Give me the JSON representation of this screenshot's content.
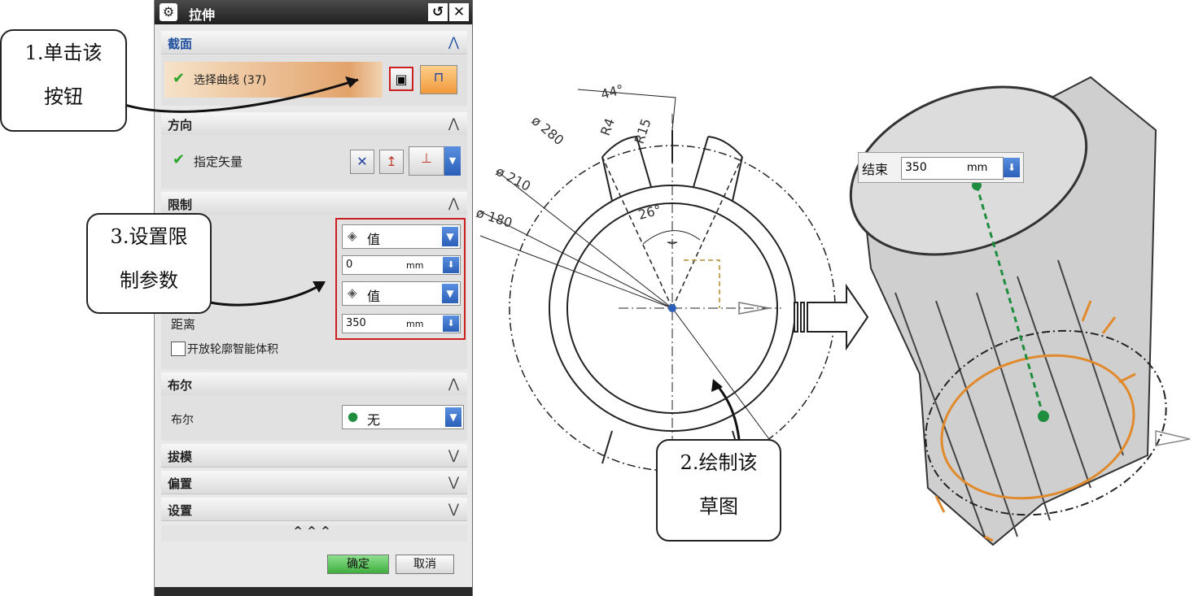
{
  "dialog": {
    "title": "拉伸",
    "reset_icon": "reset-icon",
    "close_icon": "close-icon",
    "sections": {
      "section": {
        "label": "截面",
        "expanded": true,
        "select_curve": "选择曲线 (37)"
      },
      "direction": {
        "label": "方向",
        "expanded": true,
        "specify_vector": "指定矢量"
      },
      "limits": {
        "label": "限制",
        "expanded": true,
        "start_option": "值",
        "start_value": "0",
        "start_unit": "mm",
        "end_option": "值",
        "distance_label": "距离",
        "end_value": "350",
        "end_unit": "mm",
        "open_profile_label": "开放轮廓智能体积",
        "open_profile_checked": false
      },
      "boolean": {
        "label": "布尔",
        "expanded": true,
        "field_label": "布尔",
        "value": "无"
      },
      "draft": {
        "label": "拔模",
        "expanded": false
      },
      "offset": {
        "label": "偏置",
        "expanded": false
      },
      "settings": {
        "label": "设置",
        "expanded": false
      }
    },
    "more_label": "^^^",
    "ok_label": "确定",
    "cancel_label": "取消"
  },
  "callouts": {
    "step1": [
      "1.单击该",
      "按钮"
    ],
    "step2": [
      "2.绘制该",
      "草图"
    ],
    "step3": [
      "3.设置限",
      "制参数"
    ]
  },
  "sketch": {
    "dim_angle_44": "44°",
    "dim_angle_26": "26°",
    "dim_r4": "R4",
    "dim_r15": "R15",
    "dim_d280": "ø 280",
    "dim_d210": "ø 210",
    "dim_d180": "ø 180"
  },
  "model": {
    "end_label": "结束",
    "end_value": "350",
    "end_unit": "mm"
  },
  "colors": {
    "highlight": "#e08a2c",
    "arrow_blue": "#2c5fb8",
    "callout_box": "#cc2020",
    "ok_green": "#5dbf5d"
  }
}
